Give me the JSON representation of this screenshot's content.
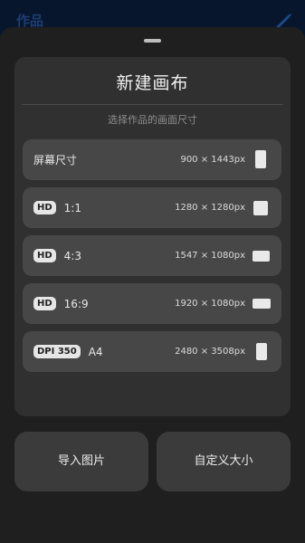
{
  "background_app": {
    "title": "作品"
  },
  "dialog": {
    "title": "新建画布",
    "subtitle": "选择作品的画面尺寸"
  },
  "options": [
    {
      "badge": "",
      "label": "屏幕尺寸",
      "size": "900 × 1443px",
      "shape": "portrait"
    },
    {
      "badge": "HD",
      "label": "1:1",
      "size": "1280 × 1280px",
      "shape": "square"
    },
    {
      "badge": "HD",
      "label": "4:3",
      "size": "1547 × 1080px",
      "shape": "landscape"
    },
    {
      "badge": "HD",
      "label": "16:9",
      "size": "1920 × 1080px",
      "shape": "wide"
    },
    {
      "badge": "DPI 350",
      "label": "A4",
      "size": "2480 × 3508px",
      "shape": "portrait"
    }
  ],
  "actions": {
    "import_label": "导入图片",
    "custom_label": "自定义大小"
  },
  "colors": {
    "sheet_bg": "#1f1f1f",
    "dialog_bg": "#303030",
    "option_bg": "#474747",
    "button_bg": "#3b3b3b"
  }
}
